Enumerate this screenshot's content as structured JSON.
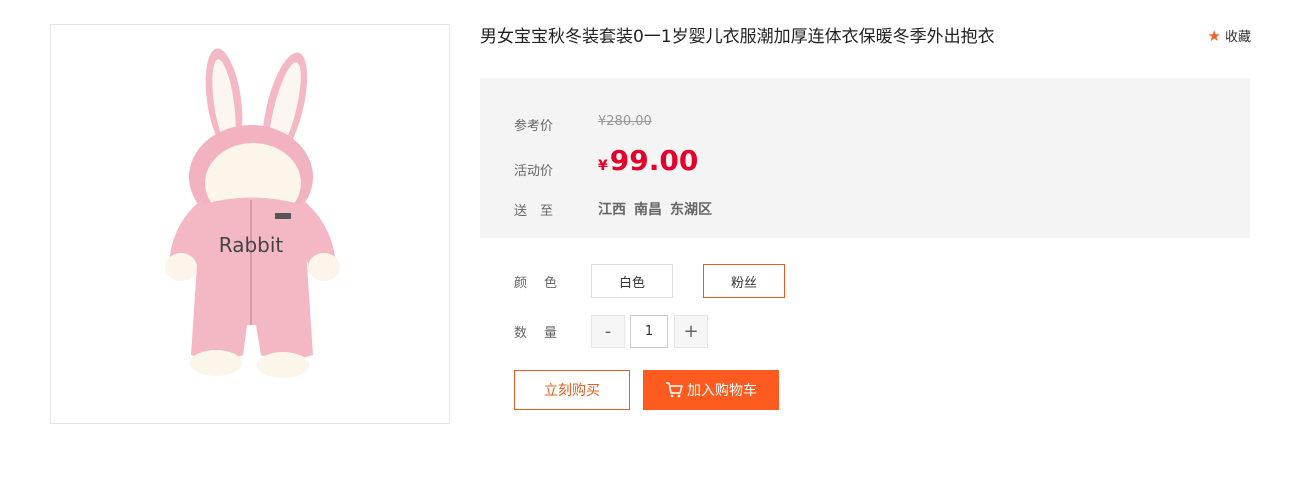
{
  "product": {
    "title": "男女宝宝秋冬装套装0一1岁婴儿衣服潮加厚连体衣保暖冬季外出抱衣",
    "image_text": "Rabbit",
    "favorite_label": "收藏"
  },
  "price": {
    "ref_label": "参考价",
    "ref_value": "¥280.00",
    "act_label": "活动价",
    "act_currency": "¥",
    "act_value": "99.00",
    "ship_label": "送　至",
    "ship_province": "江西",
    "ship_city": "南昌",
    "ship_district": "东湖区"
  },
  "options": {
    "color_label": "颜　色",
    "colors": [
      "白色",
      "粉丝"
    ],
    "selected_color": "粉丝",
    "qty_label": "数　量",
    "qty_minus": "-",
    "qty_plus": "+",
    "qty_value": "1"
  },
  "actions": {
    "buy_now": "立刻购买",
    "add_cart": "加入购物车"
  },
  "colors": {
    "accent": "#ff5a1f",
    "price_red": "#e4002b",
    "panel_bg": "#f4f4f4"
  }
}
